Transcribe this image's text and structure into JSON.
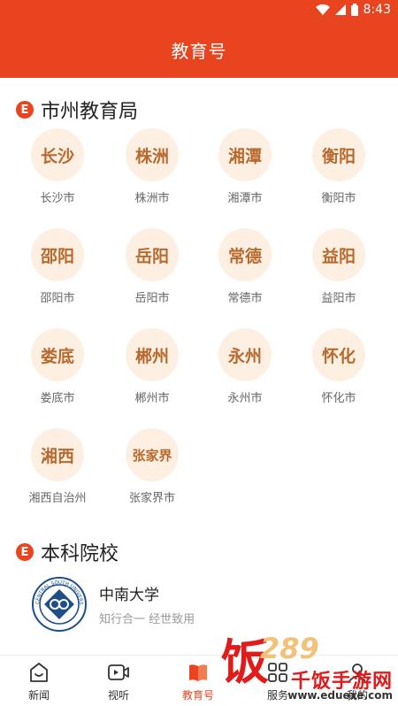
{
  "status": {
    "time": "8:43"
  },
  "header": {
    "title": "教育号"
  },
  "section_city": {
    "badge": "E",
    "title": "市州教育局"
  },
  "cities": [
    {
      "short": "长沙",
      "label": "长沙市"
    },
    {
      "short": "株洲",
      "label": "株洲市"
    },
    {
      "short": "湘潭",
      "label": "湘潭市"
    },
    {
      "short": "衡阳",
      "label": "衡阳市"
    },
    {
      "short": "邵阳",
      "label": "邵阳市"
    },
    {
      "short": "岳阳",
      "label": "岳阳市"
    },
    {
      "short": "常德",
      "label": "常德市"
    },
    {
      "short": "益阳",
      "label": "益阳市"
    },
    {
      "short": "娄底",
      "label": "娄底市"
    },
    {
      "short": "郴州",
      "label": "郴州市"
    },
    {
      "short": "永州",
      "label": "永州市"
    },
    {
      "short": "怀化",
      "label": "怀化市"
    },
    {
      "short": "湘西",
      "label": "湘西自治州"
    },
    {
      "short": "张家界",
      "label": "张家界市"
    }
  ],
  "section_uni": {
    "badge": "E",
    "title": "本科院校"
  },
  "university": {
    "name": "中南大学",
    "motto": "知行合一 经世致用",
    "logo_text": "CENTRAL SOUTH UNIVERSITY"
  },
  "tabs": [
    {
      "label": "新闻",
      "icon": "news-icon"
    },
    {
      "label": "视听",
      "icon": "video-icon"
    },
    {
      "label": "教育号",
      "icon": "education-icon"
    },
    {
      "label": "服务",
      "icon": "service-icon"
    },
    {
      "label": "我的",
      "icon": "profile-icon"
    }
  ],
  "watermark": {
    "brand": "千饭手游网",
    "number": "289",
    "site": "www.eduexe.com",
    "glyph": "饭"
  },
  "colors": {
    "primary": "#e8441f",
    "circle_bg": "#fdf0e2",
    "circle_text": "#b86a2e"
  }
}
